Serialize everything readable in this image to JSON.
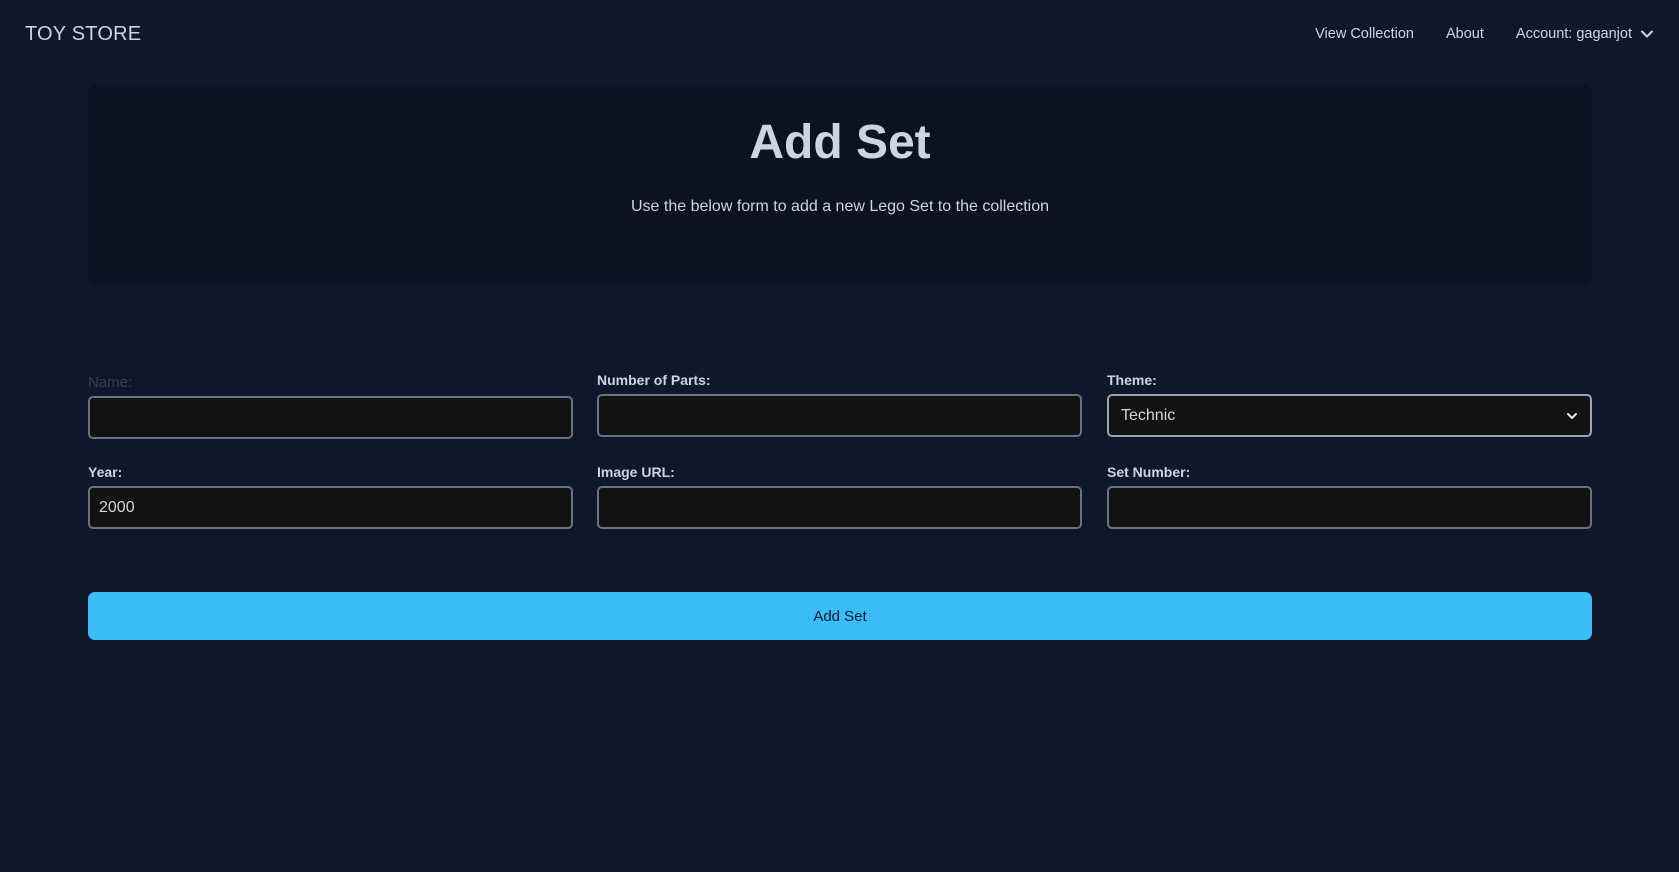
{
  "navbar": {
    "brand": "TOY STORE",
    "links": [
      {
        "label": "View Collection"
      },
      {
        "label": "About"
      },
      {
        "label": "Account: gaganjot",
        "icon": "chevron-down-icon"
      }
    ]
  },
  "hero": {
    "title": "Add Set",
    "subtitle": "Use the below form to add a new Lego Set to the collection"
  },
  "form": {
    "name": {
      "label": "Name:",
      "value": "",
      "placeholder": ""
    },
    "num_parts": {
      "label": "Number of Parts:",
      "value": "",
      "placeholder": ""
    },
    "theme": {
      "label": "Theme:",
      "selected": "Technic"
    },
    "year": {
      "label": "Year:",
      "value": "2000",
      "placeholder": ""
    },
    "img_url": {
      "label": "Image URL:",
      "value": "",
      "placeholder": ""
    },
    "set_num": {
      "label": "Set Number:",
      "value": "",
      "placeholder": ""
    },
    "submit_label": "Add Set"
  },
  "colors": {
    "background": "#0f172a",
    "hero_background": "#0b1222",
    "accent": "#38bdf8",
    "input_background": "#121212"
  }
}
